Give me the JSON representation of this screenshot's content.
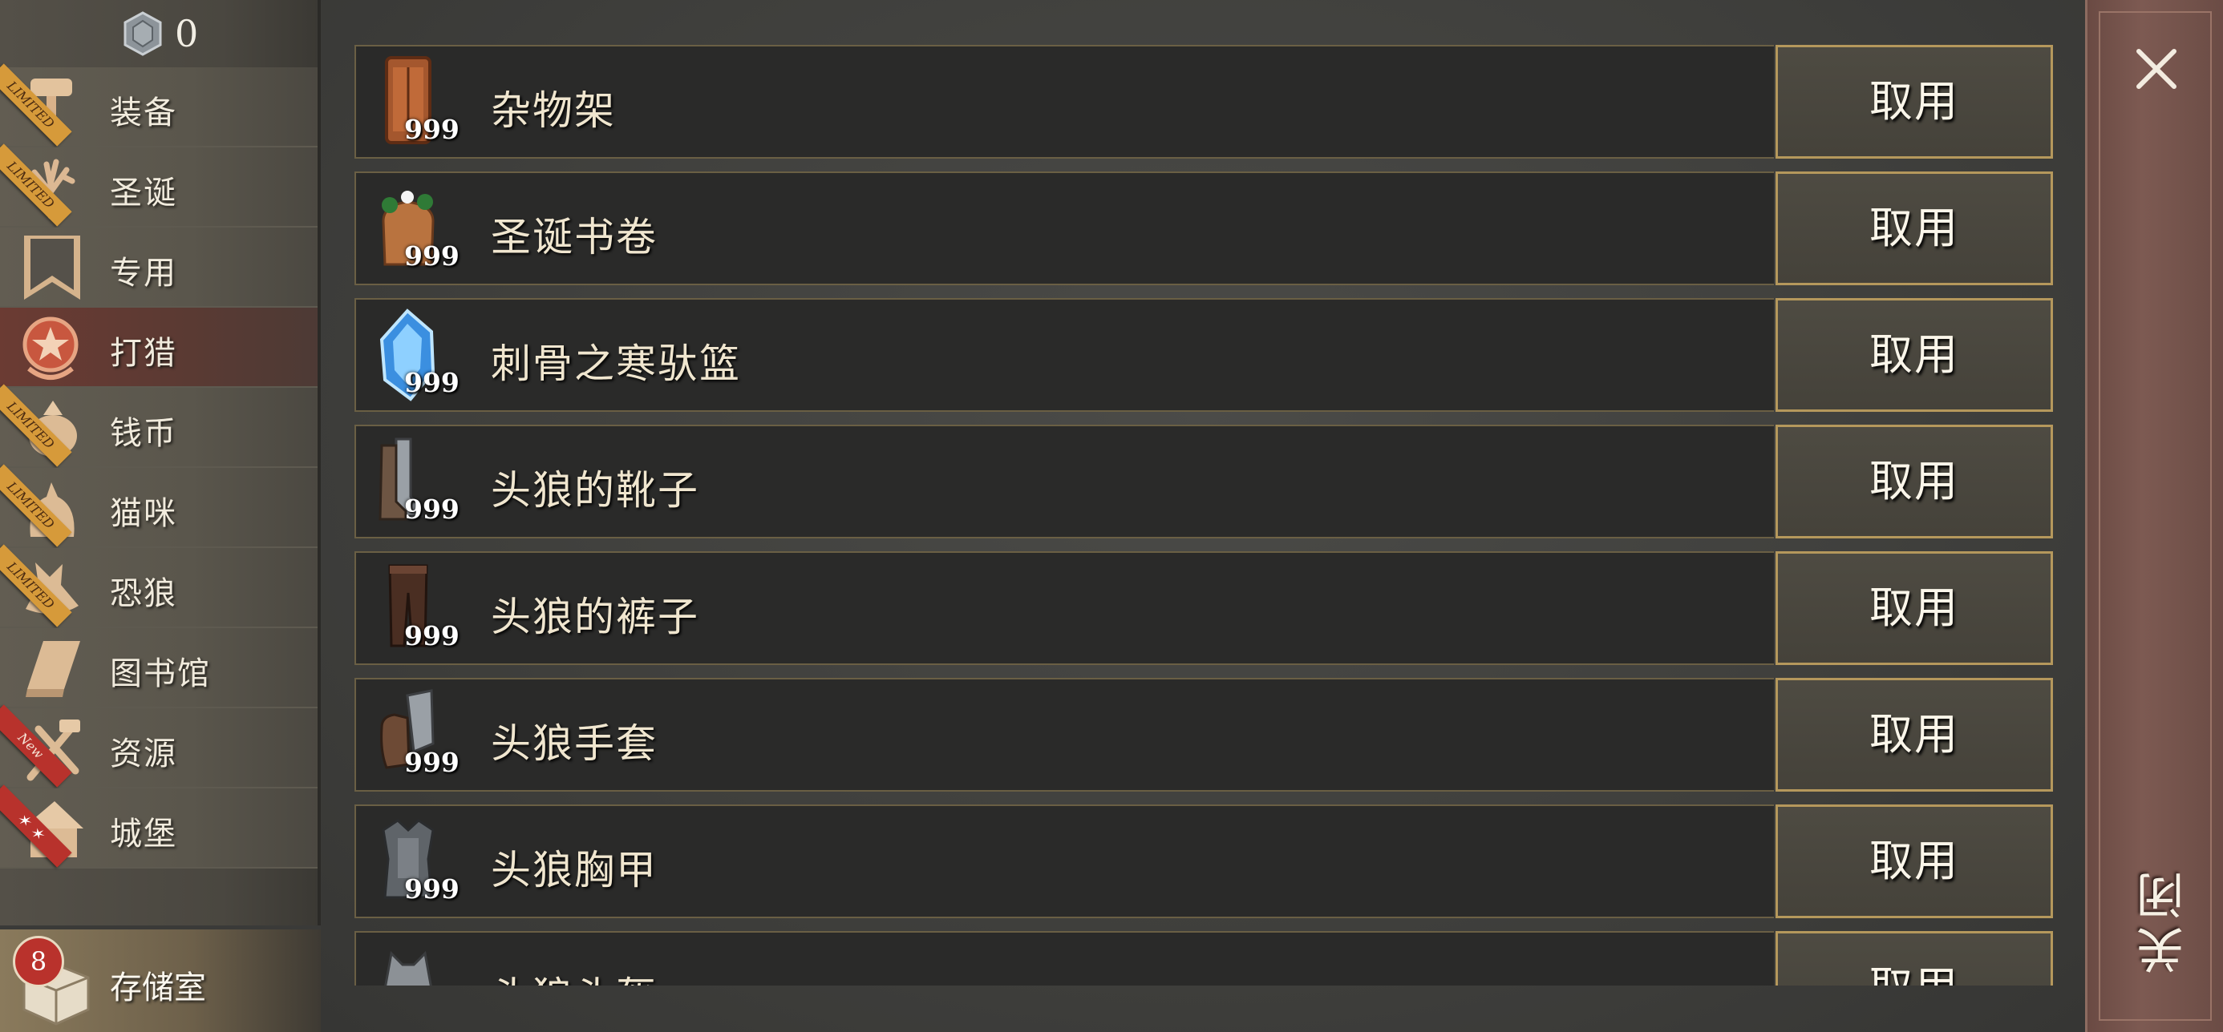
{
  "currency": {
    "icon": "gem-icon",
    "value": "0"
  },
  "sidebar": {
    "items": [
      {
        "label": "装备",
        "icon": "hammer-icon",
        "ribbon": "LIMITED"
      },
      {
        "label": "圣诞",
        "icon": "antler-icon",
        "ribbon": "LIMITED"
      },
      {
        "label": "专用",
        "icon": "banner-icon",
        "ribbon": ""
      },
      {
        "label": "打猎",
        "icon": "star-emblem-icon",
        "ribbon": ""
      },
      {
        "label": "钱币",
        "icon": "coin-pouch-icon",
        "ribbon": "LIMITED"
      },
      {
        "label": "猫咪",
        "icon": "cat-icon",
        "ribbon": "LIMITED"
      },
      {
        "label": "恐狼",
        "icon": "wolf-icon",
        "ribbon": "LIMITED"
      },
      {
        "label": "图书馆",
        "icon": "book-icon",
        "ribbon": ""
      },
      {
        "label": "资源",
        "icon": "tools-icon",
        "ribbon": "New"
      },
      {
        "label": "城堡",
        "icon": "house-icon",
        "ribbon": "✶ ✶"
      }
    ],
    "active_index": 3
  },
  "storage": {
    "label": "存储室",
    "badge": "8",
    "icon": "storage-box-icon"
  },
  "items": [
    {
      "name": "杂物架",
      "count": "999",
      "icon": "cabinet-icon",
      "button": "取用"
    },
    {
      "name": "圣诞书卷",
      "count": "999",
      "icon": "bag-icon",
      "button": "取用"
    },
    {
      "name": "刺骨之寒驮篮",
      "count": "999",
      "icon": "ice-crystal-icon",
      "button": "取用"
    },
    {
      "name": "头狼的靴子",
      "count": "999",
      "icon": "boots-icon",
      "button": "取用"
    },
    {
      "name": "头狼的裤子",
      "count": "999",
      "icon": "pants-icon",
      "button": "取用"
    },
    {
      "name": "头狼手套",
      "count": "999",
      "icon": "gloves-icon",
      "button": "取用"
    },
    {
      "name": "头狼胸甲",
      "count": "999",
      "icon": "chestplate-icon",
      "button": "取用"
    },
    {
      "name": "头狼头盔",
      "count": "",
      "icon": "helmet-icon",
      "button": "取用"
    }
  ],
  "close": {
    "label": "关闭",
    "icon": "close-icon"
  }
}
